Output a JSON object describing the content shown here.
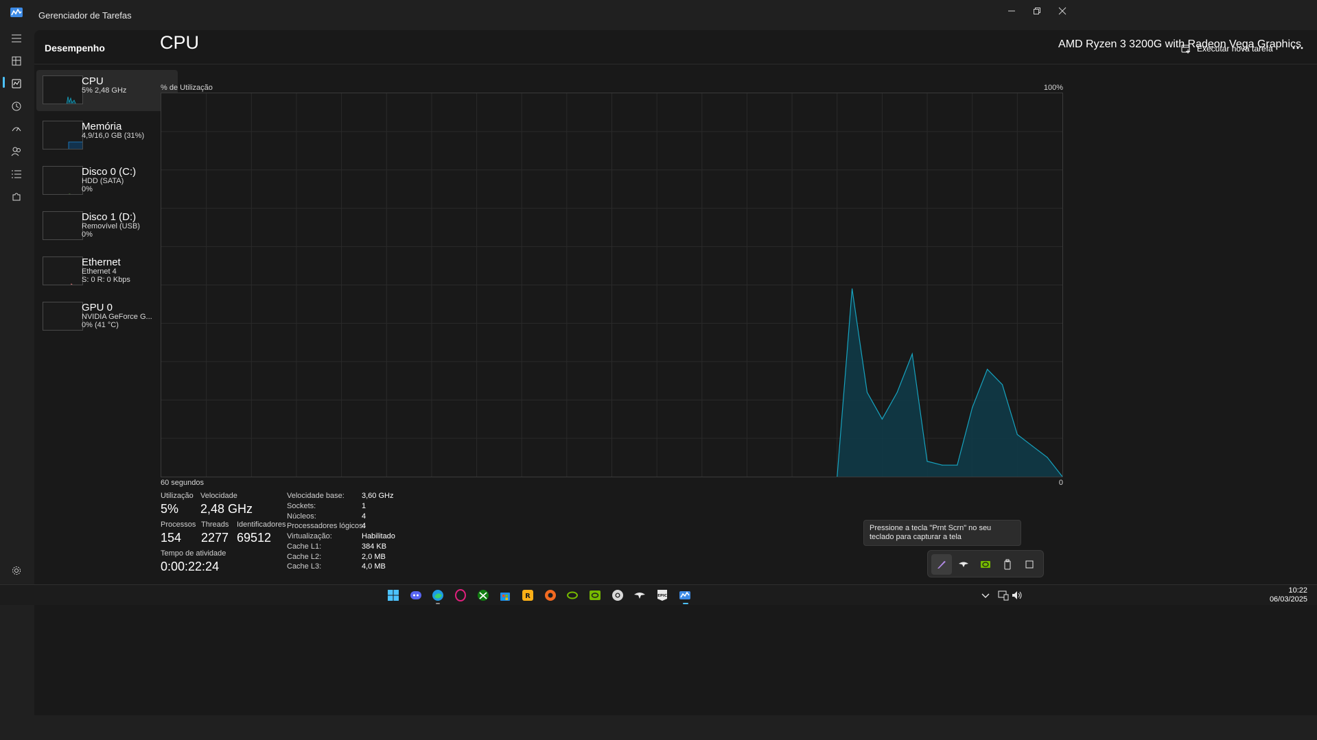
{
  "window": {
    "title": "Gerenciador de Tarefas"
  },
  "header": {
    "page_title": "Desempenho",
    "run_task_label": "Executar nova tarefa"
  },
  "resources": [
    {
      "name": "CPU",
      "line1": "5% 2,48 GHz",
      "line2": ""
    },
    {
      "name": "Memória",
      "line1": "4,9/16,0 GB (31%)",
      "line2": ""
    },
    {
      "name": "Disco 0 (C:)",
      "line1": "HDD (SATA)",
      "line2": "0%"
    },
    {
      "name": "Disco 1 (D:)",
      "line1": "Removível (USB)",
      "line2": "0%"
    },
    {
      "name": "Ethernet",
      "line1": "Ethernet 4",
      "line2": "S: 0 R: 0 Kbps"
    },
    {
      "name": "GPU 0",
      "line1": "NVIDIA GeForce G...",
      "line2": "0% (41 °C)"
    }
  ],
  "cpu": {
    "title": "CPU",
    "model": "AMD Ryzen 3 3200G with Radeon Vega Graphics",
    "graph_ylabel": "% de Utilização",
    "graph_ymax": "100%",
    "graph_xlabel": "60 segundos",
    "graph_xmin": "0",
    "stats": {
      "utilization_label": "Utilização",
      "utilization": "5%",
      "speed_label": "Velocidade",
      "speed": "2,48 GHz",
      "processes_label": "Processos",
      "processes": "154",
      "threads_label": "Threads",
      "threads": "2277",
      "handles_label": "Identificadores",
      "handles": "69512",
      "uptime_label": "Tempo de atividade",
      "uptime": "0:00:22:24"
    },
    "specs": [
      {
        "key": "Velocidade base:",
        "value": "3,60 GHz"
      },
      {
        "key": "Sockets:",
        "value": "1"
      },
      {
        "key": "Núcleos:",
        "value": "4"
      },
      {
        "key": "Processadores lógicos:",
        "value": "4"
      },
      {
        "key": "Virtualização:",
        "value": "Habilitado"
      },
      {
        "key": "Cache L1:",
        "value": "384 KB"
      },
      {
        "key": "Cache L2:",
        "value": "2,0 MB"
      },
      {
        "key": "Cache L3:",
        "value": "4,0 MB"
      }
    ]
  },
  "chart_data": {
    "type": "area",
    "ylabel": "% de Utilização",
    "xlabel": "60 segundos",
    "ylim": [
      0,
      100
    ],
    "xlim": [
      60,
      0
    ],
    "x": [
      15,
      14,
      13,
      12,
      11,
      10,
      9,
      8,
      7,
      6,
      5,
      4,
      3,
      2,
      1,
      0
    ],
    "values": [
      0,
      49,
      22,
      15,
      22,
      32,
      4,
      3,
      3,
      18,
      28,
      24,
      11,
      8,
      5,
      0
    ],
    "grid": true,
    "color": "#17a3bf"
  },
  "tooltip": {
    "text": "Pressione a tecla \"Prnt Scrn\" no seu teclado para capturar a tela"
  },
  "taskbar": {
    "time": "10:22",
    "date": "06/03/2025"
  },
  "colors": {
    "accent": "#4cc2ff",
    "cpu_graph": "#17a3bf",
    "memory_graph": "#1e88d4",
    "disk_graph": "#6cc04a",
    "ethernet_graph": "#d16d6d"
  }
}
